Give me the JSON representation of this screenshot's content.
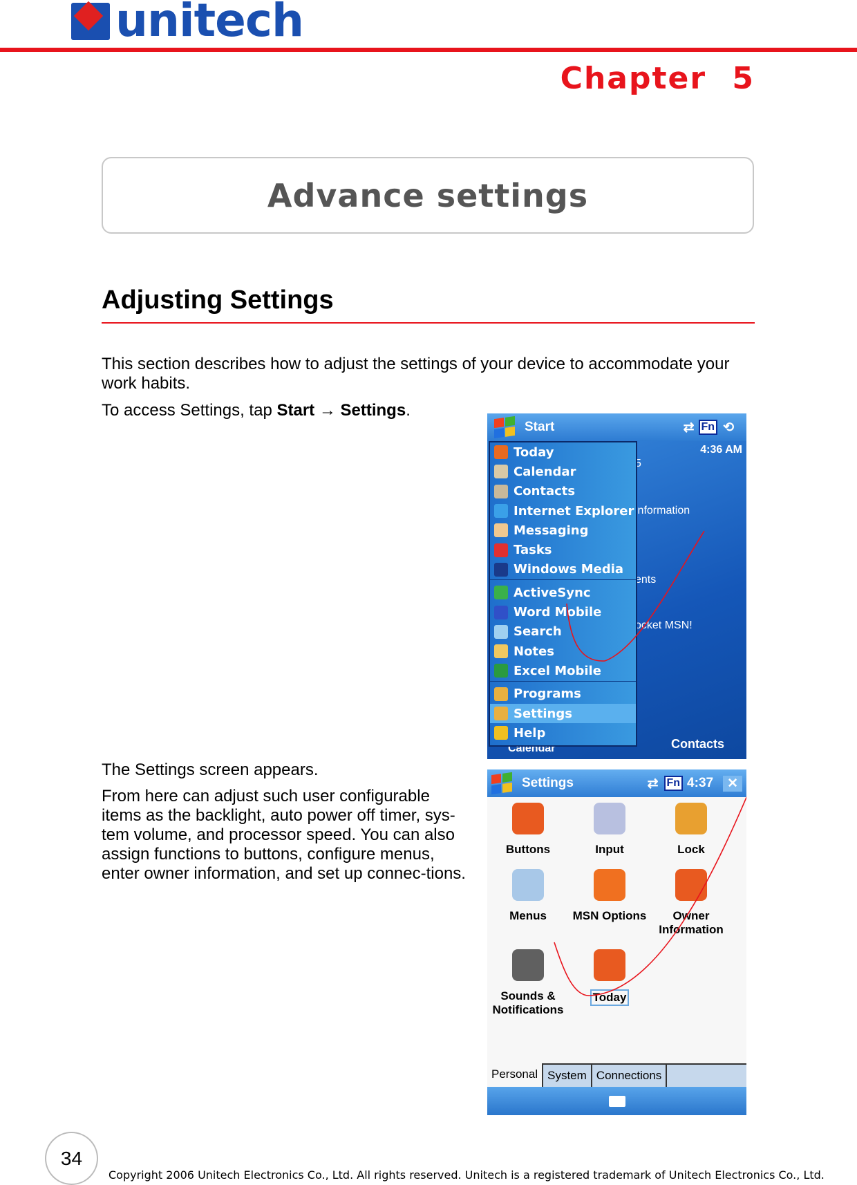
{
  "header": {
    "logo_text": "unitech",
    "chapter_label": "Chapter",
    "chapter_number": "5",
    "brand_color": "#1a4fb0",
    "accent_color": "#e8141c"
  },
  "chapter_title": "Advance settings",
  "section": {
    "heading": "Adjusting Settings",
    "intro": "This section describes how to adjust the settings of your device to accommodate your work habits.",
    "access_prefix": "To access Settings, tap ",
    "access_start": "Start",
    "access_arrow": " → ",
    "access_settings": "Settings",
    "access_suffix": ".",
    "appears": "The Settings screen appears.",
    "description": "From here can adjust such user configurable items as the backlight, auto power off timer, sys-tem volume, and processor speed. You can also assign functions to buttons, configure menus, enter owner information, and set up connec-tions."
  },
  "start_screen": {
    "title": "Start",
    "fn": "Fn",
    "time": "4:36 AM",
    "bg_text": [
      "5",
      "information",
      "ents",
      "ocket MSN!"
    ],
    "softkey_left": "Calendar",
    "softkey_right": "Contacts",
    "menu": [
      {
        "label": "Today",
        "icon": "today-icon",
        "color": "#e86a20"
      },
      {
        "label": "Calendar",
        "icon": "calendar-icon",
        "color": "#d9c9a6"
      },
      {
        "label": "Contacts",
        "icon": "contacts-icon",
        "color": "#c8b89a"
      },
      {
        "label": "Internet Explorer",
        "icon": "internet-explorer-icon",
        "color": "#3aa0e8"
      },
      {
        "label": "Messaging",
        "icon": "messaging-icon",
        "color": "#f0c890"
      },
      {
        "label": "Tasks",
        "icon": "tasks-icon",
        "color": "#e03030"
      },
      {
        "label": "Windows Media",
        "icon": "windows-media-icon",
        "color": "#1a3a8a"
      },
      {
        "label": "ActiveSync",
        "icon": "activesync-icon",
        "color": "#3ab04a"
      },
      {
        "label": "Word Mobile",
        "icon": "word-icon",
        "color": "#3050c8"
      },
      {
        "label": "Search",
        "icon": "search-icon",
        "color": "#a0d0f0"
      },
      {
        "label": "Notes",
        "icon": "notes-icon",
        "color": "#f0c860"
      },
      {
        "label": "Excel Mobile",
        "icon": "excel-icon",
        "color": "#2a9a40"
      },
      {
        "label": "Programs",
        "icon": "programs-folder-icon",
        "color": "#e8b040"
      },
      {
        "label": "Settings",
        "icon": "settings-folder-icon",
        "color": "#e8b040"
      },
      {
        "label": "Help",
        "icon": "help-icon",
        "color": "#f0c020"
      }
    ]
  },
  "settings_screen": {
    "title": "Settings",
    "fn": "Fn",
    "time": "4:37",
    "close": "✕",
    "items": [
      {
        "label": "Buttons",
        "icon": "buttons-icon",
        "color": "#e85a20"
      },
      {
        "label": "Input",
        "icon": "keyboard-icon",
        "color": "#b8c0e0"
      },
      {
        "label": "Lock",
        "icon": "lock-key-icon",
        "color": "#e8a030"
      },
      {
        "label": "Menus",
        "icon": "menus-icon",
        "color": "#a8c8e8"
      },
      {
        "label": "MSN Options",
        "icon": "msn-butterfly-icon",
        "color": "#f07020"
      },
      {
        "label": "Owner Information",
        "icon": "owner-icon",
        "color": "#e85a20"
      },
      {
        "label": "Sounds & Notifications",
        "icon": "speaker-icon",
        "color": "#606060"
      },
      {
        "label": "Today",
        "icon": "today-icon",
        "color": "#e85a20"
      }
    ],
    "tabs": [
      "Personal",
      "System",
      "Connections"
    ],
    "active_tab": "Personal"
  },
  "footer": {
    "page_number": "34",
    "copyright": "Copyright 2006 Unitech Electronics Co., Ltd. All rights reserved. Unitech is a registered trademark of Unitech Electronics Co., Ltd."
  }
}
